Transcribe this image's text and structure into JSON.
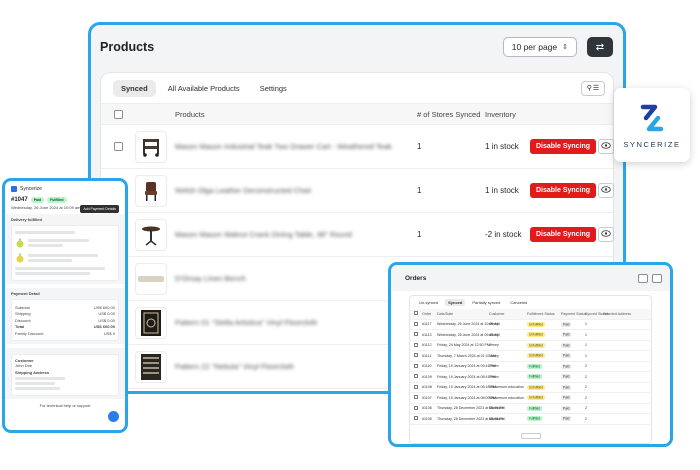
{
  "main": {
    "title": "Products",
    "per_page": "10 per page",
    "tabs": [
      {
        "label": "Synced",
        "active": true
      },
      {
        "label": "All Available Products",
        "active": false
      },
      {
        "label": "Settings",
        "active": false
      }
    ],
    "columns": {
      "products": "Products",
      "stores": "# of Stores Synced",
      "inventory": "Inventory"
    },
    "disable_label": "Disable Syncing",
    "rows": [
      {
        "name": "Mason Mason Industrial Teak Two Drawer Cart - Weathered Teak",
        "stores": "1",
        "inventory": "1 in stock",
        "thumb": "cart-icon",
        "synced": true
      },
      {
        "name": "Welsh Olga Leather Deconstructed Chair",
        "stores": "1",
        "inventory": "1 in stock",
        "thumb": "chair-icon",
        "synced": true
      },
      {
        "name": "Mason Mason Walnut Crank Dining Table, 38\" Round",
        "stores": "1",
        "inventory": "-2 in stock",
        "thumb": "table-icon",
        "synced": true
      },
      {
        "name": "D'Orsay Linen Bench",
        "stores": "",
        "inventory": "",
        "thumb": "bench-icon",
        "synced": false
      },
      {
        "name": "Pattern 01 \"Stella Artistica\" Vinyl Floorcloth",
        "stores": "",
        "inventory": "",
        "thumb": "rug-icon",
        "synced": false
      },
      {
        "name": "Pattern 22 \"Nebula\" Vinyl Floorcloth",
        "stores": "",
        "inventory": "",
        "thumb": "rug-icon",
        "synced": false
      }
    ]
  },
  "logo": {
    "text": "SYNCERIZE"
  },
  "phone": {
    "app_name": "Syncerize",
    "order_no": "#1047",
    "status_paid": "Paid",
    "status_ful": "Fulfilled",
    "date_line": "Wednesday, 26 June 2024 at 10:09 am",
    "add_btn": "Add Payment Details",
    "section_delivery": "Delivery fulfilled",
    "section_payment": "Payment Detail",
    "payment_lines": [
      {
        "label": "Subtotal",
        "value": "US$ 600.00"
      },
      {
        "label": "Shipping",
        "value": "US$ 0.00"
      },
      {
        "label": "Discount",
        "value": "US$ 0.00"
      },
      {
        "label": "Total",
        "value": "US$ 600.00"
      },
      {
        "label": "Family Discount",
        "value": "US$ 0"
      }
    ],
    "customer_label": "Customer",
    "customer_name": "John Doe",
    "shipping_label": "Shipping Address",
    "footer": "For technical help or support"
  },
  "tablet": {
    "title": "Orders",
    "tabs": [
      "Un-synced",
      "Synced",
      "Partially synced",
      "Canceled"
    ],
    "active_tab": 1,
    "columns": [
      "",
      "Order",
      "Date/Date",
      "Customer",
      "Fulfillment Status",
      "Payment Status",
      "Synced Stores",
      "Selected Address"
    ],
    "rows": [
      {
        "order": "#1117",
        "date": "Wednesday, 26 June 2024 at 10:09 AM",
        "customer": "dfmey",
        "ful": "Unfulfilled",
        "pay": "Paid",
        "stores": "1"
      },
      {
        "order": "#1113",
        "date": "Wednesday, 26 June 2024 at 09:43 AM",
        "customer": "dfmey",
        "ful": "Unfulfilled",
        "pay": "Paid",
        "stores": "1"
      },
      {
        "order": "#1112",
        "date": "Friday, 24 May 2024 at 12:50 PM",
        "customer": "dfmey",
        "ful": "Unfulfilled",
        "pay": "Paid",
        "stores": "1"
      },
      {
        "order": "#1111",
        "date": "Thursday, 7 March 2024 at 01:37 AM",
        "customer": "dfmey",
        "ful": "Unfulfilled",
        "pay": "Paid",
        "stores": "1"
      },
      {
        "order": "#1110",
        "date": "Friday, 19 January 2024 at 09:41 PM",
        "customer": "Reem",
        "ful": "Fulfilled",
        "pay": "Paid",
        "stores": "2"
      },
      {
        "order": "#1109",
        "date": "Friday, 19 January 2024 at 08:41 PM",
        "customer": "Reem",
        "ful": "Fulfilled",
        "pay": "Paid",
        "stores": "2"
      },
      {
        "order": "#1108",
        "date": "Friday, 19 January 2024 at 08:18 PM",
        "customer": "Sensemum.education",
        "ful": "Unfulfilled",
        "pay": "Paid",
        "stores": "2"
      },
      {
        "order": "#1107",
        "date": "Friday, 19 January 2024 at 08:09 PM",
        "customer": "Sensemum.education",
        "ful": "Unfulfilled",
        "pay": "Paid",
        "stores": "2"
      },
      {
        "order": "#1106",
        "date": "Thursday, 28 December 2023 at 08:49 PM",
        "customer": "Monsoon",
        "ful": "Fulfilled",
        "pay": "Paid",
        "stores": "2"
      },
      {
        "order": "#1105",
        "date": "Thursday, 28 December 2023 at 08:48 PM",
        "customer": "Monsoon",
        "ful": "Fulfilled",
        "pay": "Paid",
        "stores": "2"
      }
    ]
  },
  "colors": {
    "accent": "#2aa6e8",
    "danger": "#e11a1a"
  }
}
